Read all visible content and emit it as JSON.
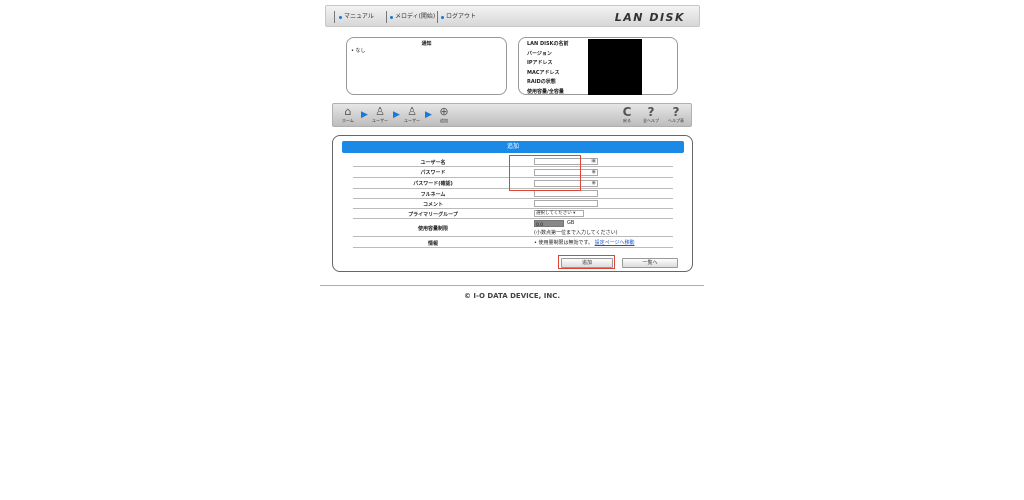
{
  "header": {
    "links": [
      {
        "label": "マニュアル"
      },
      {
        "label": "メロディ(開始)"
      },
      {
        "label": "ログアウト"
      }
    ],
    "logo": "LAN DISK"
  },
  "notice": {
    "title": "通知",
    "items": [
      "なし"
    ]
  },
  "sysinfo": {
    "rows": [
      "LAN DISKの名前",
      "バージョン",
      "IPアドレス",
      "MACアドレス",
      "RAIDの状態",
      "使用容量/全容量"
    ]
  },
  "nav": {
    "crumbs": [
      {
        "icon": "⌂",
        "label": "ホーム"
      },
      {
        "icon": "♙",
        "label": "ユーザー"
      },
      {
        "icon": "♙",
        "label": "ユーザー"
      },
      {
        "icon": "⊕",
        "label": "追加"
      }
    ],
    "right": [
      {
        "icon": "C",
        "label": "戻る"
      },
      {
        "icon": "?",
        "label": "全ヘルプ"
      },
      {
        "icon": "?",
        "label": "ヘルプ表"
      }
    ]
  },
  "form": {
    "title": "追加",
    "fields": {
      "username": "ユーザー名",
      "password": "パスワード",
      "password_confirm": "パスワード(確認)",
      "fullname": "フルネーム",
      "comment": "コメント",
      "primary_group": "プライマリーグループ",
      "quota": "使用容量制限",
      "info": "情報"
    },
    "group_select": "選択してください",
    "quota_value": "0.0",
    "quota_unit": "GB",
    "quota_hint": "(小数点第一位まで入力してください)",
    "info_text": "使用量制限は無効です。",
    "info_link": "設定ページへ移動"
  },
  "buttons": {
    "add": "追加",
    "list": "一覧へ"
  },
  "footer": {
    "copyright": "© I-O DATA DEVICE, INC."
  },
  "colors": {
    "accent": "#1a8ae6",
    "highlight": "#d43"
  }
}
